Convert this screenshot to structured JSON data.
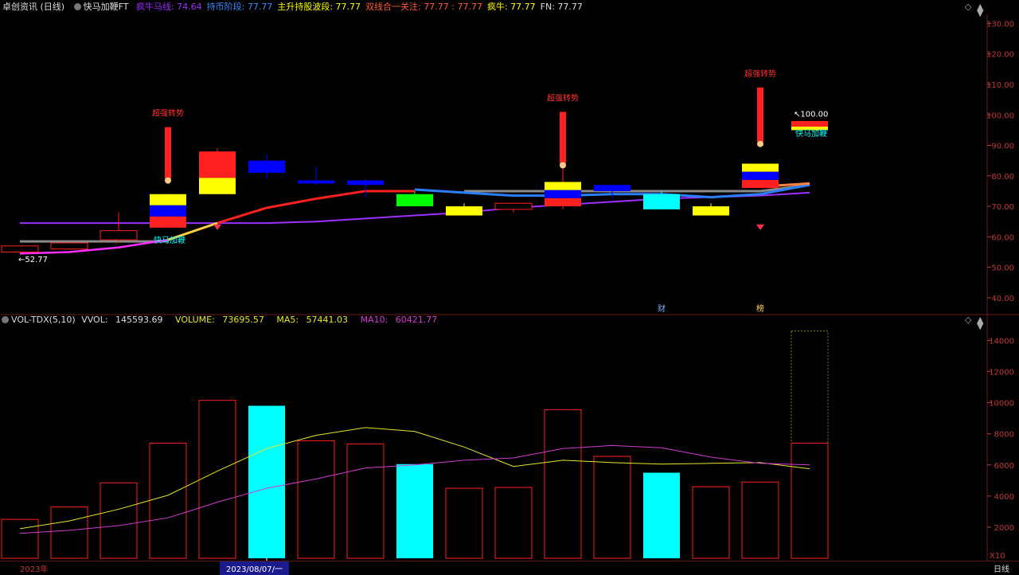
{
  "main_header": {
    "title": "卓创资讯 (日线)",
    "indicator": "快马加鞭FT",
    "items": [
      {
        "label": "疯牛马线:",
        "value": "74.64",
        "color": "#9b30ff"
      },
      {
        "label": "持币阶段:",
        "value": "77.77",
        "color": "#3b8bff"
      },
      {
        "label": "主升持股波段:",
        "value": "77.77",
        "color": "#ffff00"
      },
      {
        "label": "双线合一关注:",
        "value": "77.77 : 77.77",
        "color": "#ff5a3c"
      },
      {
        "label": "疯牛:",
        "value": "77.77",
        "color": "#ffff00"
      },
      {
        "label": "FN:",
        "value": "77.77",
        "color": "#dddddd"
      }
    ]
  },
  "vol_header": {
    "indicator": "VOL-TDX(5,10)",
    "vvol_label": "VVOL:",
    "vvol_value": "145593.69",
    "volume_label": "VOLUME:",
    "volume_value": "73695.57",
    "ma5_label": "MA5:",
    "ma5_value": "57441.03",
    "ma10_label": "MA10:",
    "ma10_value": "60421.77"
  },
  "icons": [
    "diamond-icon",
    "up-arrow-icon",
    "down-arrow-icon"
  ],
  "colors": {
    "up": "#ff2020",
    "down_cyan": "#00ffff",
    "yellow": "#ffff00",
    "blue": "#0000ff",
    "green": "#00ff00",
    "purple": "#9b30ff",
    "gray": "#8a8a8a",
    "axis": "#c03838",
    "ma5": "#e6e62a",
    "ma10": "#d23cd2"
  },
  "chart_data": [
    {
      "type": "candlestick",
      "ylim": [
        35,
        133
      ],
      "ticks": [
        "130.00",
        "120.00",
        "110.00",
        "100.00",
        "90.00",
        "80.00",
        "70.00",
        "60.00",
        "50.00",
        "40.00"
      ],
      "tick_values": [
        130,
        120,
        110,
        100,
        90,
        80,
        70,
        60,
        50,
        40
      ],
      "candles": [
        {
          "o": 55,
          "c": 57,
          "h": 57,
          "l": 55,
          "style": "hollow"
        },
        {
          "o": 56,
          "c": 58,
          "h": 58,
          "l": 56,
          "style": "hollow"
        },
        {
          "o": 59,
          "c": 62,
          "h": 68,
          "l": 58,
          "style": "hollow"
        },
        {
          "o": 63,
          "c": 74,
          "h": 74,
          "l": 63,
          "style": "rby"
        },
        {
          "o": 74,
          "c": 88,
          "h": 89,
          "l": 74,
          "style": "ry"
        },
        {
          "o": 81,
          "c": 85,
          "h": 87,
          "l": 79,
          "style": "blue"
        },
        {
          "o": 77.5,
          "c": 78.5,
          "h": 83,
          "l": 77,
          "style": "blue"
        },
        {
          "o": 77,
          "c": 78.5,
          "h": 79,
          "l": 73,
          "style": "blue"
        },
        {
          "o": 70,
          "c": 74,
          "h": 75,
          "l": 70,
          "style": "green"
        },
        {
          "o": 67,
          "c": 70,
          "h": 71,
          "l": 67,
          "style": "yellow"
        },
        {
          "o": 69,
          "c": 71,
          "h": 71,
          "l": 68,
          "style": "hollow"
        },
        {
          "o": 70,
          "c": 78,
          "h": 83,
          "l": 69,
          "style": "rby"
        },
        {
          "o": 75,
          "c": 77,
          "h": 77,
          "l": 73,
          "style": "blue"
        },
        {
          "o": 69,
          "c": 74,
          "h": 75,
          "l": 69,
          "style": "cyan"
        },
        {
          "o": 67,
          "c": 70,
          "h": 71,
          "l": 67,
          "style": "yellow"
        },
        {
          "o": 76,
          "c": 84,
          "h": 84,
          "l": 76,
          "style": "rby"
        },
        {
          "o": 95,
          "c": 98,
          "h": 98,
          "l": 95,
          "style": "ry"
        }
      ],
      "purple_line": [
        64.5,
        64.5,
        64.5,
        64.5,
        64.5,
        64.5,
        65,
        66,
        67,
        68,
        69.5,
        70.5,
        71.5,
        72.5,
        73,
        73.5,
        74.5
      ],
      "gray_line": [
        58.5,
        58.5,
        58.5,
        58.5,
        null,
        null,
        null,
        null,
        null,
        75,
        75,
        75,
        75,
        75,
        75,
        75,
        77
      ],
      "blue_line": [
        null,
        null,
        null,
        null,
        null,
        null,
        null,
        null,
        75.5,
        74.5,
        73.5,
        73.5,
        74,
        74,
        73,
        74,
        77
      ],
      "pink_line": [
        54.5,
        55,
        56.5,
        59,
        null,
        null,
        null,
        null,
        null,
        null,
        null,
        null,
        null,
        null,
        null,
        null,
        null
      ],
      "trend_line": [
        null,
        null,
        null,
        59,
        64.5,
        69.5,
        72.5,
        75,
        75,
        null,
        null,
        null,
        null,
        null,
        null,
        76.5,
        77.5
      ],
      "spikes": [
        {
          "i": 3,
          "from": 79,
          "to": 96
        },
        {
          "i": 11,
          "from": 84,
          "to": 101
        },
        {
          "i": 15,
          "from": 91,
          "to": 109
        }
      ],
      "annotations": [
        {
          "text": "超强转势",
          "i": 3
        },
        {
          "text": "超强转势",
          "i": 11
        },
        {
          "text": "超强转势",
          "i": 15
        },
        {
          "text": "快马加鞭",
          "i": 3
        },
        {
          "text": "快马加鞭",
          "i": 16
        }
      ],
      "gem_markers": [
        4,
        15
      ],
      "price_labels": [
        {
          "text": "←52.77",
          "i": 0,
          "y": 52.77
        },
        {
          "text": "↖100.00",
          "i": 16,
          "y": 100
        }
      ],
      "bottom_markers": [
        {
          "text": "财",
          "i": 13
        },
        {
          "text": "榜",
          "i": 15
        }
      ]
    },
    {
      "type": "bar",
      "title": "VOL-TDX(5,10)",
      "ylim": [
        0,
        15200
      ],
      "ticks": [
        "14000",
        "12000",
        "10000",
        "8000",
        "6000",
        "4000",
        "2000"
      ],
      "tick_values": [
        14000,
        12000,
        10000,
        8000,
        6000,
        4000,
        2000
      ],
      "unit_label": "X10",
      "values": [
        2500,
        3300,
        4850,
        7400,
        10150,
        9800,
        7550,
        7350,
        6050,
        4500,
        4550,
        9550,
        6550,
        5500,
        4600,
        4900,
        7400
      ],
      "styles": [
        "hollow",
        "hollow",
        "hollow",
        "hollow",
        "hollow",
        "cyan",
        "hollow",
        "hollow",
        "cyan",
        "hollow",
        "hollow",
        "hollow",
        "hollow",
        "cyan",
        "hollow",
        "hollow",
        "hollow"
      ],
      "vvol_bar": {
        "i": 16,
        "value": 14600
      },
      "ma5": [
        1900,
        2400,
        3150,
        4050,
        5600,
        7050,
        7900,
        8400,
        8150,
        7150,
        5900,
        6300,
        6150,
        6050,
        6100,
        6150,
        5750
      ],
      "ma10": [
        1600,
        1800,
        2100,
        2600,
        3600,
        4500,
        5100,
        5800,
        6000,
        6300,
        6450,
        7050,
        7250,
        7100,
        6500,
        6100,
        6000
      ]
    }
  ],
  "x_axis": {
    "left_label": "2023年",
    "cursor_label": "2023/08/07/一",
    "cursor_i": 5,
    "period": "日线"
  }
}
